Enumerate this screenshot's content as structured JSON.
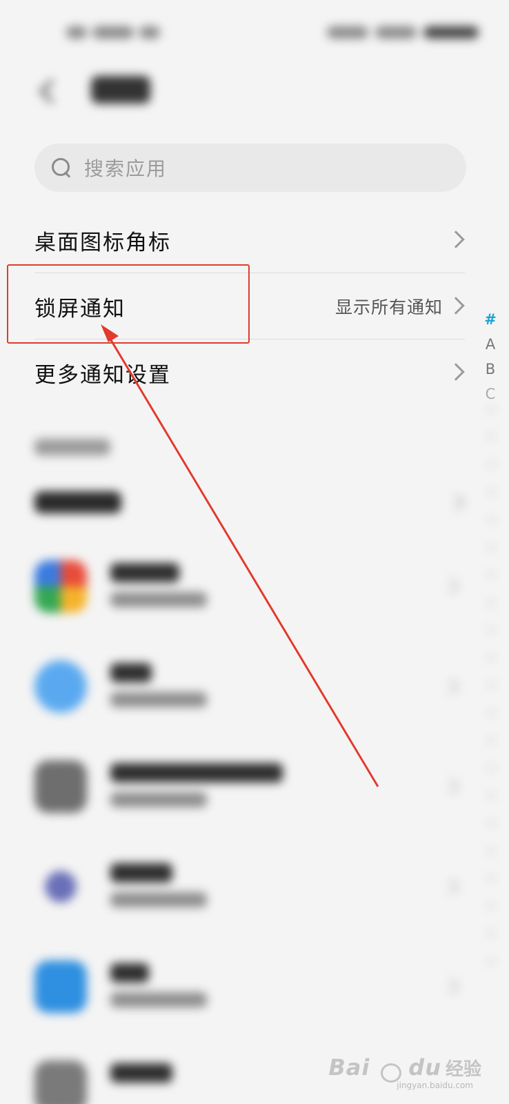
{
  "search": {
    "placeholder": "搜索应用"
  },
  "settings": [
    {
      "label": "桌面图标角标",
      "value": ""
    },
    {
      "label": "锁屏通知",
      "value": "显示所有通知"
    },
    {
      "label": "更多通知设置",
      "value": ""
    }
  ],
  "alpha_index": [
    "#",
    "A",
    "B",
    "C"
  ],
  "colors": {
    "accent": "#1aa3d6",
    "annotation": "#e23a2c"
  },
  "watermark": {
    "brand": "Bai",
    "brand_suffix": "du",
    "product": "经验",
    "url": "jingyan.baidu.com"
  }
}
